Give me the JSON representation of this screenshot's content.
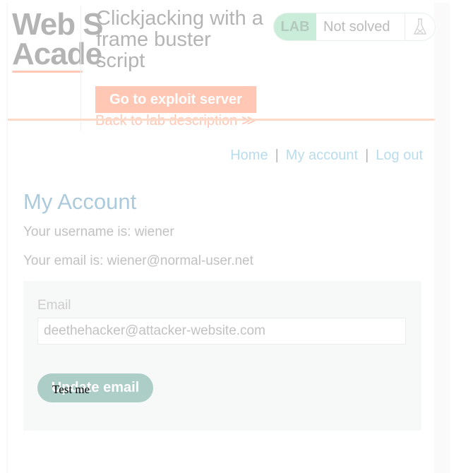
{
  "logo": {
    "line1": "Web S",
    "line2": "Acade"
  },
  "lab": {
    "title": "Clickjacking with a frame buster script",
    "tag": "LAB",
    "status": "Not solved",
    "exploit_button": "Go to exploit server",
    "back_link": "Back to lab description",
    "back_link_icon": "double-chevron-right-icon",
    "status_icon": "flask-icon"
  },
  "nav": {
    "home": "Home",
    "separator": "|",
    "my_account": "My account",
    "log_out": "Log out"
  },
  "account": {
    "title": "My Account",
    "username_line": "Your username is: wiener",
    "email_line": "Your email is: wiener@normal-user.net"
  },
  "form": {
    "email_label": "Email",
    "email_value": "deethehacker@attacker-website.com",
    "update_button": "Update email"
  },
  "decoy": {
    "text": "Test me"
  },
  "colors": {
    "brand_orange": "#ff6633",
    "lab_green": "#6fcf97",
    "link_blue": "#3fa0d0",
    "button_teal": "#1e7a66"
  }
}
